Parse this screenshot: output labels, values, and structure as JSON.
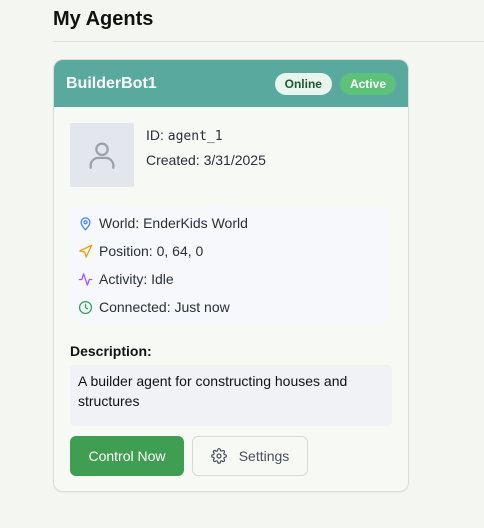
{
  "page": {
    "title": "My Agents"
  },
  "agent": {
    "name": "BuilderBot1",
    "status_badge": "Online",
    "state_badge": "Active",
    "id_label": "ID: ",
    "id_value": "agent_1",
    "created": "Created: 3/31/2025",
    "world": "World: EnderKids World",
    "position": "Position: 0, 64, 0",
    "activity": "Activity: Idle",
    "connected": "Connected: Just now",
    "description_label": "Description:",
    "description": "A builder agent for constructing houses and structures"
  },
  "actions": {
    "control_label": "Control Now",
    "settings_label": "Settings"
  },
  "icons": {
    "avatar": "user-icon",
    "world": "map-pin-icon",
    "position": "navigation-icon",
    "activity": "activity-icon",
    "connected": "clock-icon",
    "settings": "gear-icon"
  },
  "colors": {
    "header": "#5aa99f",
    "primary_button": "#3f9e52",
    "active_badge": "#5cc27a",
    "online_badge": "#e8f5ec",
    "pin_icon": "#3b82f6",
    "navigation_icon": "#f59e0b",
    "activity_icon": "#a855f7",
    "clock_icon": "#22a35a"
  }
}
